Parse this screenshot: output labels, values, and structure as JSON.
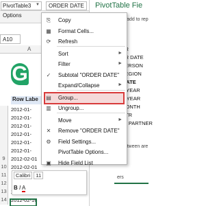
{
  "top": {
    "name_box": "PivotTable3",
    "formula_value": "ORDER DATE",
    "cell_ref": "A10"
  },
  "ribbon": {
    "options_label": "Options"
  },
  "pane": {
    "title": "PivotTable Fie",
    "subtitle": "fields to add to rep",
    "fields": [
      "TOMER",
      "ORDER DATE",
      "LES PERSON",
      "LES REGION",
      "DER DATE",
      "NDAR YEAR",
      "NCIAL YEAR",
      "LES MONTH",
      "LES QTR",
      "ANNEL PARTNER"
    ],
    "drag_text": "elds between are",
    "bottom_text": "ers"
  },
  "sheet": {
    "col_header": "A",
    "row_label": "Row Labe",
    "rows": [
      {
        "num": "",
        "value": "2012-01-"
      },
      {
        "num": "",
        "value": "2012-01-"
      },
      {
        "num": "",
        "value": "2012-01-"
      },
      {
        "num": "",
        "value": "2012-01-"
      },
      {
        "num": "",
        "value": "2012-01-"
      },
      {
        "num": "",
        "value": "2012-01-"
      },
      {
        "num": "9",
        "value": "2012-02-01"
      },
      {
        "num": "10",
        "value": "2012-02-01"
      },
      {
        "num": "11",
        "value": ""
      },
      {
        "num": "12",
        "value": ""
      },
      {
        "num": "13",
        "value": "2012-02-1"
      },
      {
        "num": "14",
        "value": "2012-02-16"
      }
    ]
  },
  "menu": {
    "items": [
      {
        "icon": "copy-icon",
        "glyph": "⎘",
        "label": "Copy",
        "arrow": "",
        "disabled": false
      },
      {
        "icon": "format-cells-icon",
        "glyph": "▦",
        "label": "Format Cells...",
        "arrow": "",
        "disabled": false
      },
      {
        "icon": "refresh-icon",
        "glyph": "⟳",
        "label": "Refresh",
        "arrow": "",
        "disabled": false
      },
      {
        "icon": "",
        "glyph": "",
        "label": "Sort",
        "arrow": "►",
        "disabled": false
      },
      {
        "icon": "",
        "glyph": "",
        "label": "Filter",
        "arrow": "►",
        "disabled": false
      },
      {
        "icon": "checkmark-icon",
        "glyph": "✓",
        "label": "Subtotal \"ORDER DATE\"",
        "arrow": "",
        "disabled": false
      },
      {
        "icon": "",
        "glyph": "",
        "label": "Expand/Collapse",
        "arrow": "►",
        "disabled": false
      },
      {
        "icon": "group-icon",
        "glyph": "▤",
        "label": "Group...",
        "arrow": "",
        "disabled": false
      },
      {
        "icon": "ungroup-icon",
        "glyph": "▥",
        "label": "Ungroup...",
        "arrow": "",
        "disabled": false
      },
      {
        "icon": "",
        "glyph": "",
        "label": "Move",
        "arrow": "►",
        "disabled": false
      },
      {
        "icon": "remove-icon",
        "glyph": "✕",
        "label": "Remove \"ORDER DATE\"",
        "arrow": "",
        "disabled": false
      },
      {
        "icon": "field-settings-icon",
        "glyph": "⚙",
        "label": "Field Settings...",
        "arrow": "",
        "disabled": false
      },
      {
        "icon": "",
        "glyph": "",
        "label": "PivotTable Options...",
        "arrow": "",
        "disabled": false
      },
      {
        "icon": "field-list-icon",
        "glyph": "▣",
        "label": "Hide Field List",
        "arrow": "",
        "disabled": false
      }
    ]
  },
  "mini_toolbar": {
    "font": "Calibri",
    "size": "11",
    "buttons": [
      "B",
      "I",
      "A"
    ]
  }
}
